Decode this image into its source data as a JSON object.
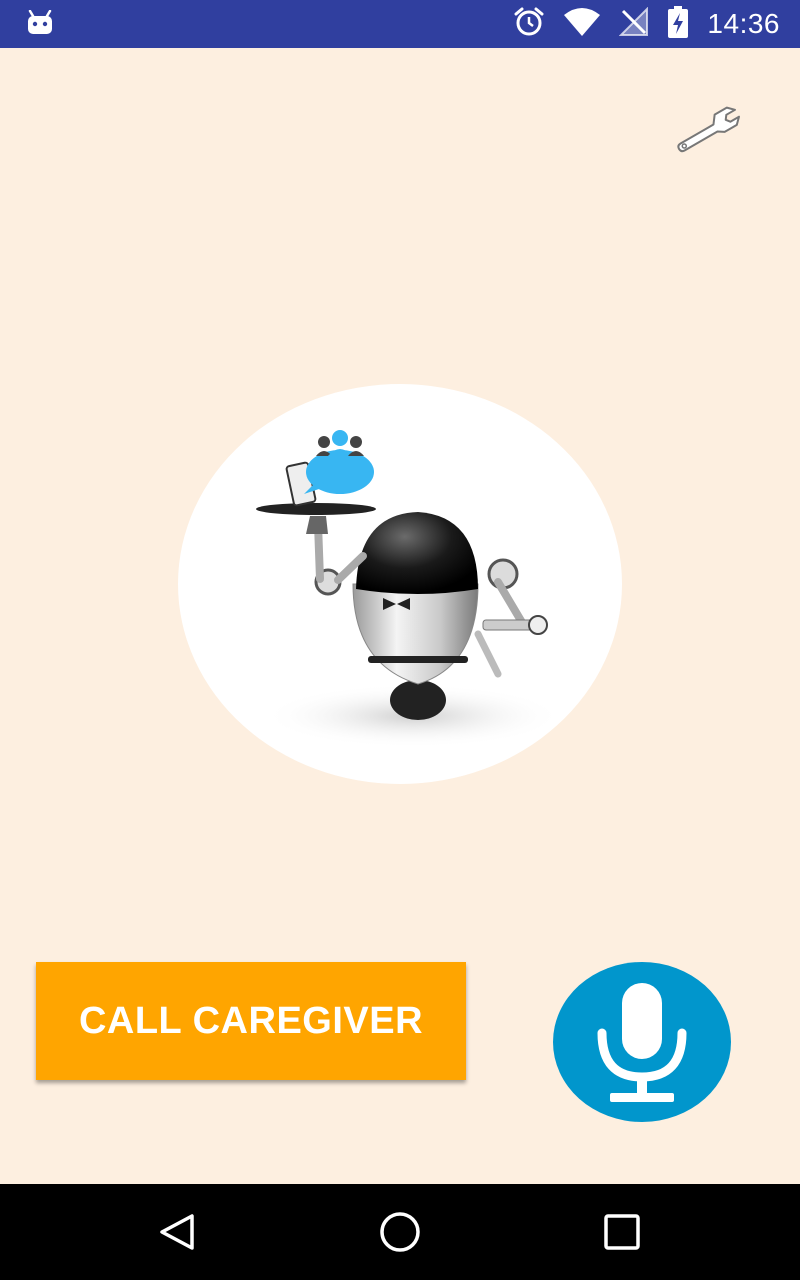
{
  "status_bar": {
    "time": "14:36",
    "icons": [
      "android-notification-icon",
      "alarm-icon",
      "wifi-icon",
      "no-signal-icon",
      "battery-charging-icon"
    ],
    "background_color": "#303F9F"
  },
  "main": {
    "settings_icon": "wrench-icon",
    "robot_image": "robot-waiter-image",
    "call_button_label": "CALL CAREGIVER",
    "call_button_color": "#FFA500",
    "mic_icon": "microphone-icon",
    "mic_button_color": "#0196CC",
    "background_color": "#FDEFE0"
  },
  "nav_bar": {
    "buttons": [
      "back-icon",
      "home-icon",
      "recents-icon"
    ]
  }
}
